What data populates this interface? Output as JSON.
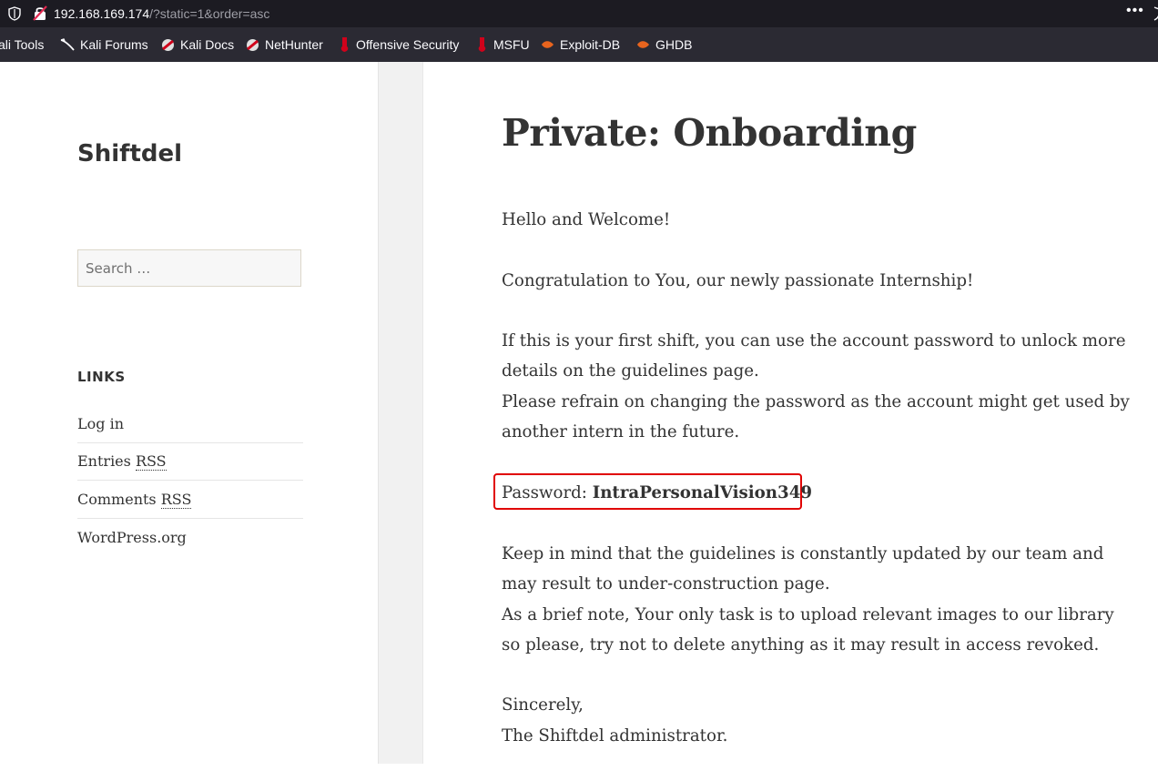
{
  "browser": {
    "url_host": "192.168.169.174",
    "url_path": "/?static=1&order=asc",
    "menu_label": "•••",
    "bookmarks": [
      {
        "label": "ali Tools",
        "icon": "kali-tools-icon"
      },
      {
        "label": "Kali Forums",
        "icon": "kali-dragon-icon"
      },
      {
        "label": "Kali Docs",
        "icon": "kali-docs-icon"
      },
      {
        "label": "NetHunter",
        "icon": "nethunter-icon"
      },
      {
        "label": "Offensive Security",
        "icon": "offsec-icon"
      },
      {
        "label": "MSFU",
        "icon": "msfu-icon"
      },
      {
        "label": "Exploit-DB",
        "icon": "exploit-db-icon"
      },
      {
        "label": "GHDB",
        "icon": "ghdb-icon"
      }
    ]
  },
  "sidebar": {
    "site_title": "Shiftdel",
    "search_placeholder": "Search …",
    "links_title": "LINKS",
    "links": [
      {
        "text": "Log in",
        "abbr": ""
      },
      {
        "text": "Entries ",
        "abbr": "RSS"
      },
      {
        "text": "Comments ",
        "abbr": "RSS"
      },
      {
        "text": "WordPress.org",
        "abbr": ""
      }
    ]
  },
  "post": {
    "title": "Private: Onboarding",
    "greeting": "Hello and Welcome!",
    "congrats": "Congratulation to You, our newly passionate Internship!",
    "first_shift_1": "If this is your first shift, you can use the account password to unlock more details on the guidelines page.",
    "first_shift_2": "Please refrain on changing the password as the account might get used by another intern in the future.",
    "password_label": "Password: ",
    "password_value": "IntraPersonalVision349",
    "keep_in_mind_1": "Keep in mind that the guidelines is constantly updated by our team and may result to under-construction page.",
    "keep_in_mind_2": "As a brief note, Your only task is to upload relevant images to our library so please, try not to delete anything as it may result in access revoked.",
    "sign_off_1": "Sincerely,",
    "sign_off_2": "The Shiftdel administrator."
  },
  "colors": {
    "highlight_border": "#e00000",
    "browser_bar": "#1c1b22",
    "bookmarks_bar": "#2b2a33"
  }
}
